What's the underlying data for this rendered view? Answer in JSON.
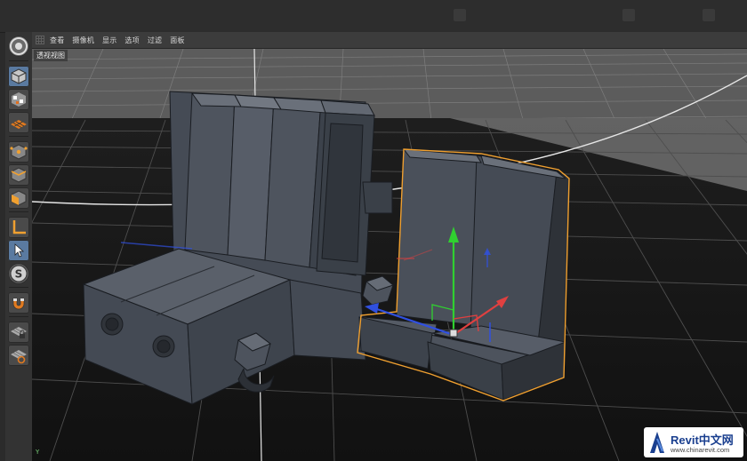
{
  "menubar": {
    "items": [
      "查看",
      "摄像机",
      "显示",
      "选项",
      "过滤",
      "面板"
    ]
  },
  "viewport": {
    "label": "透视视图",
    "axis_label": "Y"
  },
  "toolbar": {
    "tools": [
      {
        "name": "model-mode-icon",
        "active": true
      },
      {
        "name": "texture-mode-icon",
        "active": false
      },
      {
        "name": "workplane-mode-icon",
        "active": false
      },
      {
        "name": "point-mode-icon",
        "active": false
      },
      {
        "name": "edge-mode-icon",
        "active": false
      },
      {
        "name": "polygon-mode-icon",
        "active": false
      },
      {
        "name": "axis-mode-icon",
        "active": false
      },
      {
        "name": "tweak-mode-icon",
        "active": true
      },
      {
        "name": "solo-mode-icon",
        "active": false
      },
      {
        "name": "snap-magnet-icon",
        "active": false
      },
      {
        "name": "workplane-lock-icon",
        "active": false
      },
      {
        "name": "workplane-planar-icon",
        "active": false
      }
    ]
  },
  "watermark": {
    "title": "Revit中文网",
    "url": "www.chinarevit.com"
  },
  "colors": {
    "viewport_bg": "#505050",
    "selection_outline": "#f0a030",
    "axis_x": "#e04040",
    "axis_y": "#30d030",
    "axis_z": "#3050e0",
    "floor_grid_dark": "#1a1a1a",
    "floor_grid_light": "#8c8c8c"
  }
}
